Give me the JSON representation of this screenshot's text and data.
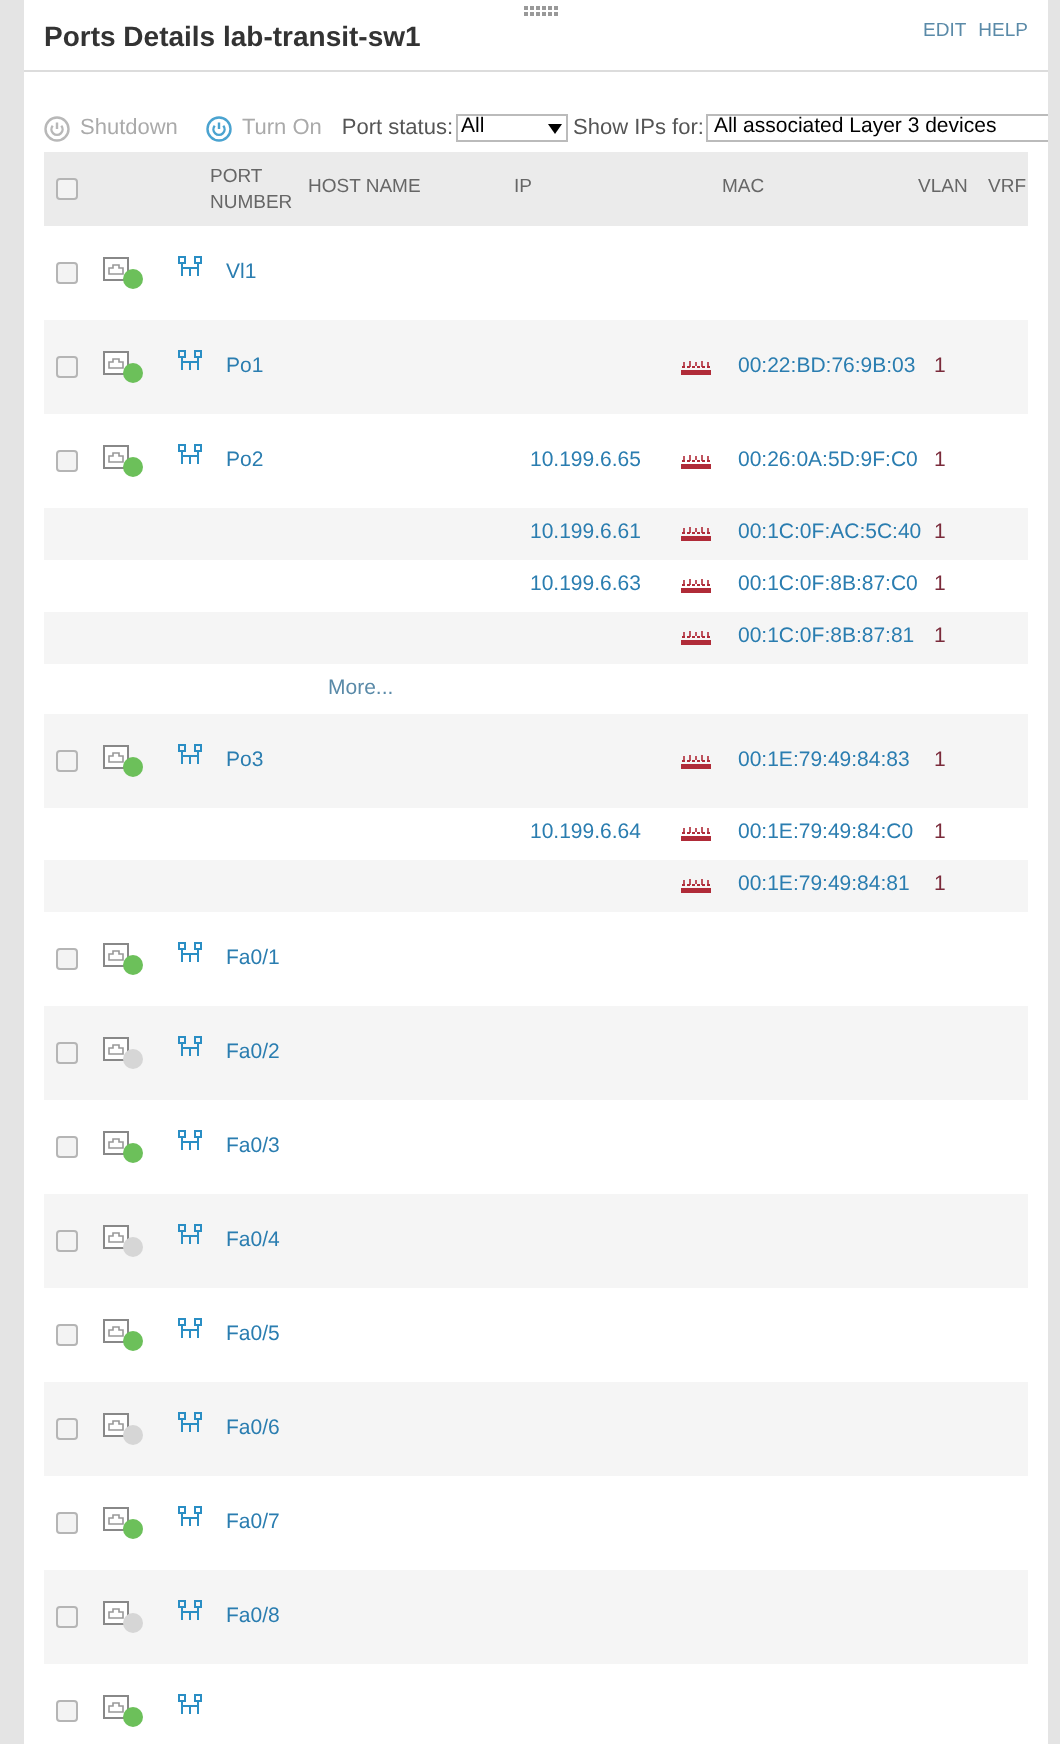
{
  "panel": {
    "title": "Ports Details lab-transit-sw1",
    "actions": [
      "EDIT",
      "HELP"
    ]
  },
  "toolbar": {
    "shutdown": "Shutdown",
    "turn_on": "Turn On",
    "port_status_label": "Port status:",
    "port_status_value": "All",
    "show_ips_label": "Show IPs for:",
    "show_ips_value": "All associated Layer 3 devices"
  },
  "table": {
    "columns": [
      "PORT NUMBER",
      "HOST NAME",
      "IP",
      "MAC",
      "VLAN",
      "VRF"
    ],
    "select_all_checked": false,
    "rows": [
      {
        "kind": "port",
        "port": "Vl1",
        "up": true,
        "checked": false
      },
      {
        "kind": "port",
        "port": "Po1",
        "up": true,
        "checked": false,
        "mac": "00:22:BD:76:9B:03",
        "vlan": "1"
      },
      {
        "kind": "port",
        "port": "Po2",
        "up": true,
        "checked": false,
        "ip": "10.199.6.65",
        "mac": "00:26:0A:5D:9F:C0",
        "vlan": "1"
      },
      {
        "kind": "sub",
        "ip": "10.199.6.61",
        "mac": "00:1C:0F:AC:5C:40",
        "vlan": "1"
      },
      {
        "kind": "sub",
        "ip": "10.199.6.63",
        "mac": "00:1C:0F:8B:87:C0",
        "vlan": "1"
      },
      {
        "kind": "sub",
        "mac": "00:1C:0F:8B:87:81",
        "vlan": "1"
      },
      {
        "kind": "more",
        "label": "More..."
      },
      {
        "kind": "port",
        "port": "Po3",
        "up": true,
        "checked": false,
        "mac": "00:1E:79:49:84:83",
        "vlan": "1"
      },
      {
        "kind": "sub",
        "ip": "10.199.6.64",
        "mac": "00:1E:79:49:84:C0",
        "vlan": "1"
      },
      {
        "kind": "sub",
        "mac": "00:1E:79:49:84:81",
        "vlan": "1"
      },
      {
        "kind": "port",
        "port": "Fa0/1",
        "up": true,
        "checked": false
      },
      {
        "kind": "port",
        "port": "Fa0/2",
        "up": false,
        "checked": false
      },
      {
        "kind": "port",
        "port": "Fa0/3",
        "up": true,
        "checked": false
      },
      {
        "kind": "port",
        "port": "Fa0/4",
        "up": false,
        "checked": false
      },
      {
        "kind": "port",
        "port": "Fa0/5",
        "up": true,
        "checked": false
      },
      {
        "kind": "port",
        "port": "Fa0/6",
        "up": false,
        "checked": false
      },
      {
        "kind": "port",
        "port": "Fa0/7",
        "up": true,
        "checked": false
      },
      {
        "kind": "port",
        "port": "Fa0/8",
        "up": false,
        "checked": false
      },
      {
        "kind": "port",
        "up": true,
        "checked": false
      }
    ]
  }
}
